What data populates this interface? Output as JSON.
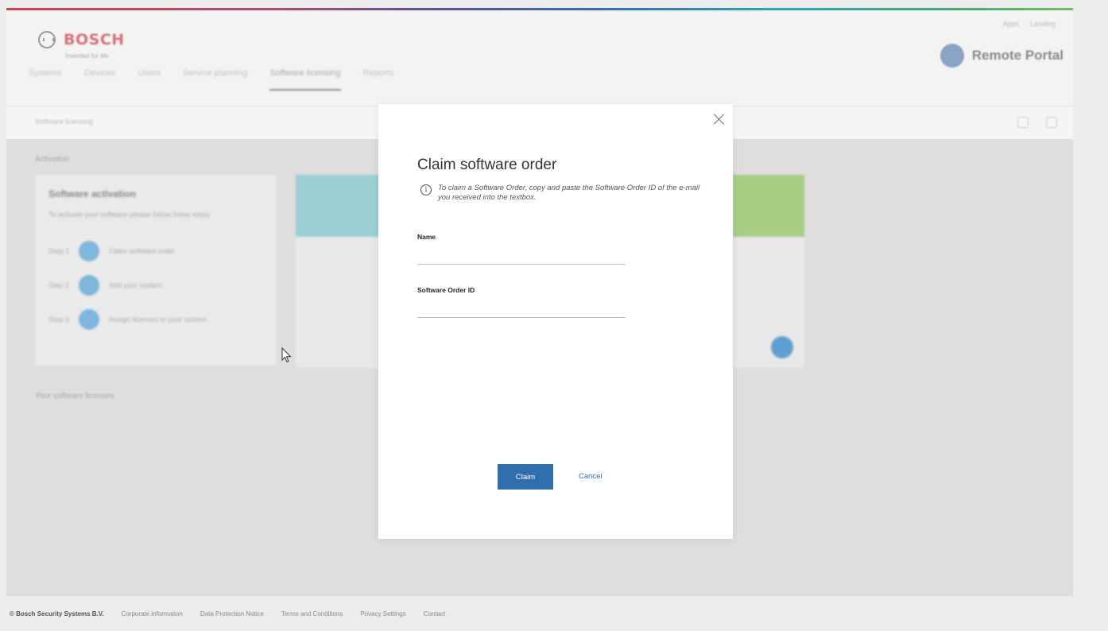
{
  "header": {
    "brand": "BOSCH",
    "slogan": "Invented for life",
    "top_links": [
      "Apps",
      "Landing"
    ],
    "portal_name": "Remote Portal"
  },
  "nav": {
    "items": [
      "Systems",
      "Devices",
      "Users",
      "Service planning",
      "Software licensing",
      "Reports"
    ],
    "active_index": 4
  },
  "subbar": {
    "breadcrumb": "Software licensing"
  },
  "content": {
    "section_title": "Activation",
    "activation_card": {
      "title": "Software activation",
      "subtitle": "To activate your software please follow these steps:",
      "steps": [
        {
          "label": "Step 1",
          "text": "Claim software order"
        },
        {
          "label": "Step 2",
          "text": "Add your system"
        },
        {
          "label": "Step 3",
          "text": "Assign licenses to your system"
        }
      ]
    },
    "section_title_2": "Your software licenses"
  },
  "modal": {
    "title": "Claim software order",
    "info_text": "To claim a Software Order, copy and paste the Software Order ID of the e-mail you received into the textbox.",
    "name_label": "Name",
    "name_value": "",
    "order_label": "Software Order ID",
    "order_value": "",
    "claim_label": "Claim",
    "cancel_label": "Cancel"
  },
  "footer": {
    "copyright": "© Bosch Security Systems B.V.",
    "links": [
      "Corporate information",
      "Data Protection Notice",
      "Terms and Conditions",
      "Privacy Settings",
      "Contact"
    ]
  },
  "colors": {
    "primary": "#2f6fae",
    "teal_card": "#9ccfd3",
    "green_card": "#a6cf84",
    "overlay_bg": "#dedede"
  },
  "icons": [
    "bosch-logo-icon",
    "remote-portal-icon",
    "close-icon",
    "info-icon",
    "mouse-cursor-icon",
    "filter-icon",
    "search-icon"
  ]
}
